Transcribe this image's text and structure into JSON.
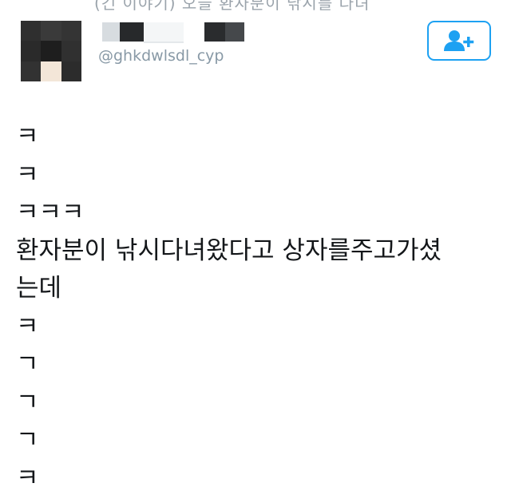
{
  "tweet": {
    "top_cutoff_text": "(긴 이야기) 오늘 환자분이 낚시를 다녀",
    "author": {
      "display_name": "",
      "handle": "@ghkdwlsdl_cyp",
      "avatar_icon": "pixelated-avatar",
      "follow_icon": "add-user-icon"
    },
    "lines": [
      "ㅋ",
      "ㅋ",
      "ㅋㅋㅋ",
      "환자분이 낚시다녀왔다고 상자를주고가셨",
      "는데",
      "ㅋ",
      "ㄱ",
      "ㄱ",
      "ㄱ",
      "ㅋ"
    ]
  },
  "colors": {
    "accent": "#1da1f2",
    "handle": "#8899a6",
    "text": "#14171a",
    "cutoff": "#9aa3ab"
  }
}
